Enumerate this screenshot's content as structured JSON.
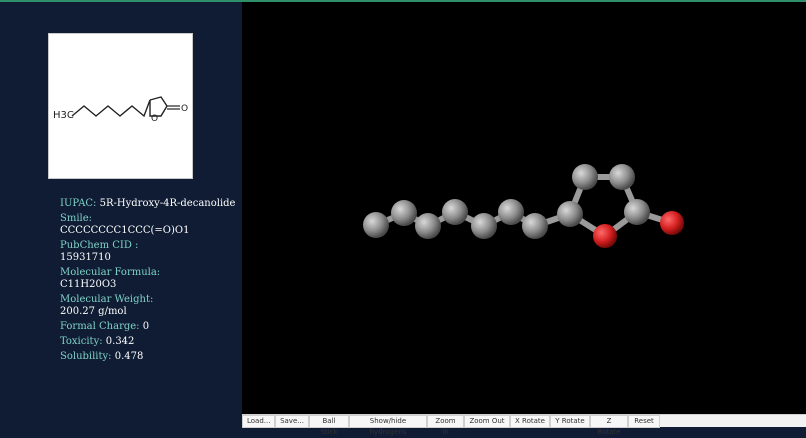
{
  "sidebar": {
    "structure": {
      "chem_text": "H3C",
      "ring_o": "O",
      "carbonyl_o": "O"
    },
    "properties": [
      {
        "label": "IUPAC:",
        "value": "5R-Hydroxy-4R-decanolide"
      },
      {
        "label": "Smile:",
        "value": "CCCCCCCC1CCC(=O)O1"
      },
      {
        "label": "PubChem CID :",
        "value": "15931710"
      },
      {
        "label": "Molecular Formula:",
        "value": "C11H20O3"
      },
      {
        "label": "Molecular Weight:",
        "value": "200.27 g/mol"
      },
      {
        "label": "Formal Charge:",
        "value": "0"
      },
      {
        "label": "Toxicity:",
        "value": "0.342"
      },
      {
        "label": "Solubility:",
        "value": "0.478"
      }
    ]
  },
  "toolbar": {
    "buttons": [
      "Load...",
      "Save...",
      "Ball Stick",
      "Show/hide hydrogens",
      "Zoom In",
      "Zoom Out",
      "X Rotate",
      "Y Rotate",
      "Z Rotate",
      "Reset"
    ]
  },
  "colors": {
    "sidebar_bg": "#0f1c33",
    "label": "#7fd3c8",
    "carbon": "#8a8a8a",
    "oxygen": "#d42020",
    "viewer_bg": "#000000"
  }
}
